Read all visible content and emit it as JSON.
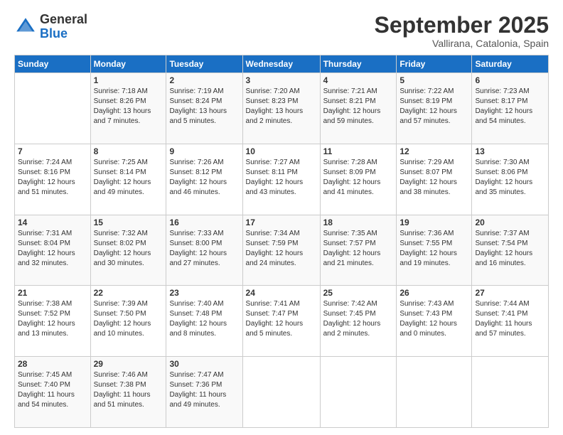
{
  "logo": {
    "general": "General",
    "blue": "Blue"
  },
  "header": {
    "month": "September 2025",
    "location": "Vallirana, Catalonia, Spain"
  },
  "days_of_week": [
    "Sunday",
    "Monday",
    "Tuesday",
    "Wednesday",
    "Thursday",
    "Friday",
    "Saturday"
  ],
  "weeks": [
    [
      {
        "day": "",
        "info": ""
      },
      {
        "day": "1",
        "info": "Sunrise: 7:18 AM\nSunset: 8:26 PM\nDaylight: 13 hours\nand 7 minutes."
      },
      {
        "day": "2",
        "info": "Sunrise: 7:19 AM\nSunset: 8:24 PM\nDaylight: 13 hours\nand 5 minutes."
      },
      {
        "day": "3",
        "info": "Sunrise: 7:20 AM\nSunset: 8:23 PM\nDaylight: 13 hours\nand 2 minutes."
      },
      {
        "day": "4",
        "info": "Sunrise: 7:21 AM\nSunset: 8:21 PM\nDaylight: 12 hours\nand 59 minutes."
      },
      {
        "day": "5",
        "info": "Sunrise: 7:22 AM\nSunset: 8:19 PM\nDaylight: 12 hours\nand 57 minutes."
      },
      {
        "day": "6",
        "info": "Sunrise: 7:23 AM\nSunset: 8:17 PM\nDaylight: 12 hours\nand 54 minutes."
      }
    ],
    [
      {
        "day": "7",
        "info": "Sunrise: 7:24 AM\nSunset: 8:16 PM\nDaylight: 12 hours\nand 51 minutes."
      },
      {
        "day": "8",
        "info": "Sunrise: 7:25 AM\nSunset: 8:14 PM\nDaylight: 12 hours\nand 49 minutes."
      },
      {
        "day": "9",
        "info": "Sunrise: 7:26 AM\nSunset: 8:12 PM\nDaylight: 12 hours\nand 46 minutes."
      },
      {
        "day": "10",
        "info": "Sunrise: 7:27 AM\nSunset: 8:11 PM\nDaylight: 12 hours\nand 43 minutes."
      },
      {
        "day": "11",
        "info": "Sunrise: 7:28 AM\nSunset: 8:09 PM\nDaylight: 12 hours\nand 41 minutes."
      },
      {
        "day": "12",
        "info": "Sunrise: 7:29 AM\nSunset: 8:07 PM\nDaylight: 12 hours\nand 38 minutes."
      },
      {
        "day": "13",
        "info": "Sunrise: 7:30 AM\nSunset: 8:06 PM\nDaylight: 12 hours\nand 35 minutes."
      }
    ],
    [
      {
        "day": "14",
        "info": "Sunrise: 7:31 AM\nSunset: 8:04 PM\nDaylight: 12 hours\nand 32 minutes."
      },
      {
        "day": "15",
        "info": "Sunrise: 7:32 AM\nSunset: 8:02 PM\nDaylight: 12 hours\nand 30 minutes."
      },
      {
        "day": "16",
        "info": "Sunrise: 7:33 AM\nSunset: 8:00 PM\nDaylight: 12 hours\nand 27 minutes."
      },
      {
        "day": "17",
        "info": "Sunrise: 7:34 AM\nSunset: 7:59 PM\nDaylight: 12 hours\nand 24 minutes."
      },
      {
        "day": "18",
        "info": "Sunrise: 7:35 AM\nSunset: 7:57 PM\nDaylight: 12 hours\nand 21 minutes."
      },
      {
        "day": "19",
        "info": "Sunrise: 7:36 AM\nSunset: 7:55 PM\nDaylight: 12 hours\nand 19 minutes."
      },
      {
        "day": "20",
        "info": "Sunrise: 7:37 AM\nSunset: 7:54 PM\nDaylight: 12 hours\nand 16 minutes."
      }
    ],
    [
      {
        "day": "21",
        "info": "Sunrise: 7:38 AM\nSunset: 7:52 PM\nDaylight: 12 hours\nand 13 minutes."
      },
      {
        "day": "22",
        "info": "Sunrise: 7:39 AM\nSunset: 7:50 PM\nDaylight: 12 hours\nand 10 minutes."
      },
      {
        "day": "23",
        "info": "Sunrise: 7:40 AM\nSunset: 7:48 PM\nDaylight: 12 hours\nand 8 minutes."
      },
      {
        "day": "24",
        "info": "Sunrise: 7:41 AM\nSunset: 7:47 PM\nDaylight: 12 hours\nand 5 minutes."
      },
      {
        "day": "25",
        "info": "Sunrise: 7:42 AM\nSunset: 7:45 PM\nDaylight: 12 hours\nand 2 minutes."
      },
      {
        "day": "26",
        "info": "Sunrise: 7:43 AM\nSunset: 7:43 PM\nDaylight: 12 hours\nand 0 minutes."
      },
      {
        "day": "27",
        "info": "Sunrise: 7:44 AM\nSunset: 7:41 PM\nDaylight: 11 hours\nand 57 minutes."
      }
    ],
    [
      {
        "day": "28",
        "info": "Sunrise: 7:45 AM\nSunset: 7:40 PM\nDaylight: 11 hours\nand 54 minutes."
      },
      {
        "day": "29",
        "info": "Sunrise: 7:46 AM\nSunset: 7:38 PM\nDaylight: 11 hours\nand 51 minutes."
      },
      {
        "day": "30",
        "info": "Sunrise: 7:47 AM\nSunset: 7:36 PM\nDaylight: 11 hours\nand 49 minutes."
      },
      {
        "day": "",
        "info": ""
      },
      {
        "day": "",
        "info": ""
      },
      {
        "day": "",
        "info": ""
      },
      {
        "day": "",
        "info": ""
      }
    ]
  ]
}
